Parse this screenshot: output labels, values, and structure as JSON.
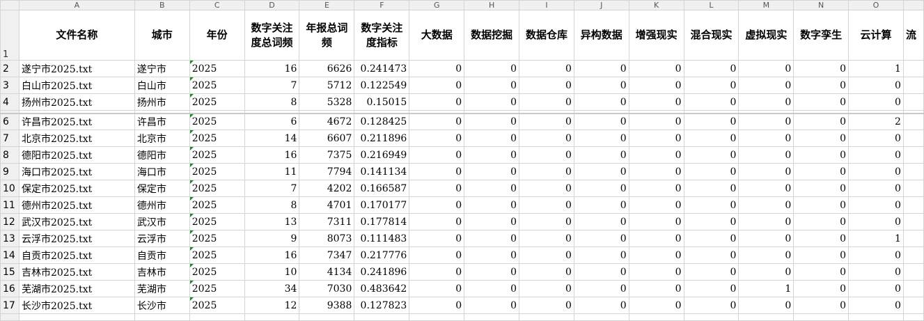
{
  "columns": [
    "A",
    "B",
    "C",
    "D",
    "E",
    "F",
    "G",
    "H",
    "I",
    "J",
    "K",
    "L",
    "M",
    "N",
    "O"
  ],
  "headers": [
    "文件名称",
    "城市",
    "年份",
    "数字关注度总词频",
    "年报总词频",
    "数字关注度指标",
    "大数据",
    "数据挖掘",
    "数据仓库",
    "异构数据",
    "增强现实",
    "混合现实",
    "虚拟现实",
    "数字孪生",
    "云计算",
    "流"
  ],
  "header_row_number": "1",
  "rows": [
    {
      "n": "2",
      "file": "遂宁市2025.txt",
      "city": "遂宁市",
      "year": "2025",
      "total": "16",
      "report": "6626",
      "index": "0.241473",
      "v": [
        "0",
        "0",
        "0",
        "0",
        "0",
        "0",
        "0",
        "0",
        "1"
      ]
    },
    {
      "n": "3",
      "file": "白山市2025.txt",
      "city": "白山市",
      "year": "2025",
      "total": "7",
      "report": "5712",
      "index": "0.122549",
      "v": [
        "0",
        "0",
        "0",
        "0",
        "0",
        "0",
        "0",
        "0",
        "0"
      ]
    },
    {
      "n": "4",
      "file": "扬州市2025.txt",
      "city": "扬州市",
      "year": "2025",
      "total": "8",
      "report": "5328",
      "index": "0.15015",
      "v": [
        "0",
        "0",
        "0",
        "0",
        "0",
        "0",
        "0",
        "0",
        "0"
      ]
    },
    {
      "n": "6",
      "file": "许昌市2025.txt",
      "city": "许昌市",
      "year": "2025",
      "total": "6",
      "report": "4672",
      "index": "0.128425",
      "v": [
        "0",
        "0",
        "0",
        "0",
        "0",
        "0",
        "0",
        "0",
        "2"
      ]
    },
    {
      "n": "7",
      "file": "北京市2025.txt",
      "city": "北京市",
      "year": "2025",
      "total": "14",
      "report": "6607",
      "index": "0.211896",
      "v": [
        "0",
        "0",
        "0",
        "0",
        "0",
        "0",
        "0",
        "0",
        "0"
      ]
    },
    {
      "n": "8",
      "file": "德阳市2025.txt",
      "city": "德阳市",
      "year": "2025",
      "total": "16",
      "report": "7375",
      "index": "0.216949",
      "v": [
        "0",
        "0",
        "0",
        "0",
        "0",
        "0",
        "0",
        "0",
        "0"
      ]
    },
    {
      "n": "9",
      "file": "海口市2025.txt",
      "city": "海口市",
      "year": "2025",
      "total": "11",
      "report": "7794",
      "index": "0.141134",
      "v": [
        "0",
        "0",
        "0",
        "0",
        "0",
        "0",
        "0",
        "0",
        "0"
      ]
    },
    {
      "n": "10",
      "file": "保定市2025.txt",
      "city": "保定市",
      "year": "2025",
      "total": "7",
      "report": "4202",
      "index": "0.166587",
      "v": [
        "0",
        "0",
        "0",
        "0",
        "0",
        "0",
        "0",
        "0",
        "0"
      ]
    },
    {
      "n": "11",
      "file": "德州市2025.txt",
      "city": "德州市",
      "year": "2025",
      "total": "8",
      "report": "4701",
      "index": "0.170177",
      "v": [
        "0",
        "0",
        "0",
        "0",
        "0",
        "0",
        "0",
        "0",
        "0"
      ]
    },
    {
      "n": "12",
      "file": "武汉市2025.txt",
      "city": "武汉市",
      "year": "2025",
      "total": "13",
      "report": "7311",
      "index": "0.177814",
      "v": [
        "0",
        "0",
        "0",
        "0",
        "0",
        "0",
        "0",
        "0",
        "0"
      ]
    },
    {
      "n": "13",
      "file": "云浮市2025.txt",
      "city": "云浮市",
      "year": "2025",
      "total": "9",
      "report": "8073",
      "index": "0.111483",
      "v": [
        "0",
        "0",
        "0",
        "0",
        "0",
        "0",
        "0",
        "0",
        "1"
      ]
    },
    {
      "n": "14",
      "file": "自贡市2025.txt",
      "city": "自贡市",
      "year": "2025",
      "total": "16",
      "report": "7347",
      "index": "0.217776",
      "v": [
        "0",
        "0",
        "0",
        "0",
        "0",
        "0",
        "0",
        "0",
        "0"
      ]
    },
    {
      "n": "15",
      "file": "吉林市2025.txt",
      "city": "吉林市",
      "year": "2025",
      "total": "10",
      "report": "4134",
      "index": "0.241896",
      "v": [
        "0",
        "0",
        "0",
        "0",
        "0",
        "0",
        "0",
        "0",
        "0"
      ]
    },
    {
      "n": "16",
      "file": "芜湖市2025.txt",
      "city": "芜湖市",
      "year": "2025",
      "total": "34",
      "report": "7030",
      "index": "0.483642",
      "v": [
        "0",
        "0",
        "0",
        "0",
        "0",
        "0",
        "1",
        "0",
        "0"
      ]
    },
    {
      "n": "17",
      "file": "长沙市2025.txt",
      "city": "长沙市",
      "year": "2025",
      "total": "12",
      "report": "9388",
      "index": "0.127823",
      "v": [
        "0",
        "0",
        "0",
        "0",
        "0",
        "0",
        "0",
        "0",
        "0"
      ]
    }
  ],
  "colors": {
    "header_bg": "#f0f0f0",
    "grid": "#d4d4d4",
    "text_flag": "#1e8a1e"
  }
}
